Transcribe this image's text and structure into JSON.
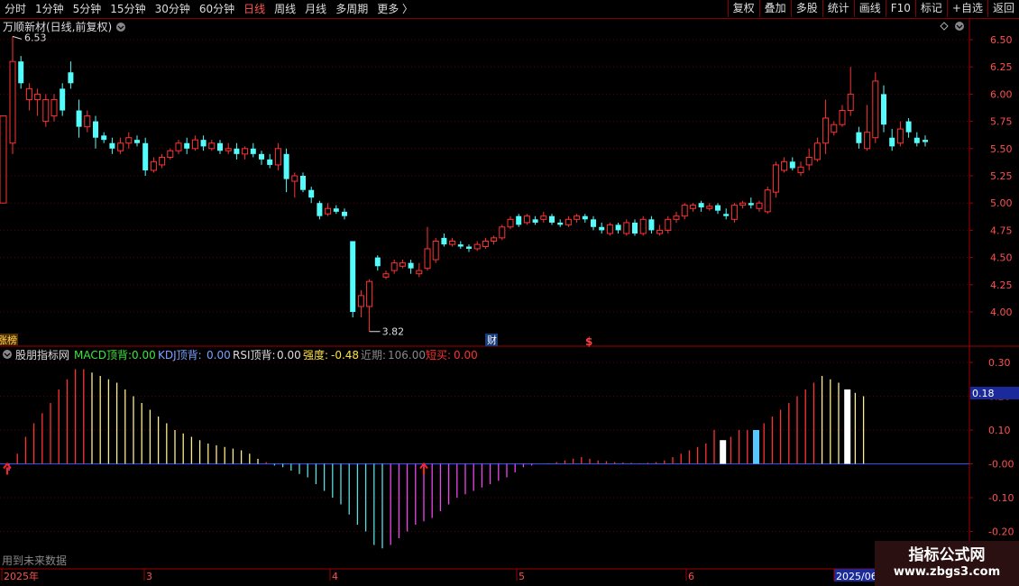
{
  "toolbar": {
    "items": [
      "分时",
      "1分钟",
      "5分钟",
      "15分钟",
      "30分钟",
      "60分钟",
      "日线",
      "周线",
      "月线",
      "多周期",
      "更多 〉"
    ],
    "active_index": 6,
    "right_buttons": [
      "复权",
      "叠加",
      "多股",
      "统计",
      "画线",
      "F10",
      "标记",
      "+自选",
      "返回"
    ]
  },
  "main_chart": {
    "title": "万顺新材(日线,前复权)",
    "high_label": "6.53",
    "low_label": "3.82",
    "price_ticks": [
      "6.50",
      "6.25",
      "6.00",
      "5.75",
      "5.50",
      "5.25",
      "5.00",
      "4.75",
      "4.50",
      "4.25",
      "4.00"
    ],
    "left_tag": "涨榜",
    "event_cai": "财",
    "event_dollar": "$",
    "colors": {
      "up": "#ff3232",
      "down": "#54fcfc",
      "grid": "#5a0000",
      "axis": "#a00000"
    }
  },
  "indicator": {
    "name": "股朋指标网",
    "macd_label": "MACD顶背:",
    "macd_value": "0.00",
    "kdj_label": "KDJ顶背:",
    "kdj_value": "0.00",
    "rsi_label": "RSI顶背:",
    "rsi_value": "0.00",
    "strength_label": "强度:",
    "strength_value": "-0.48",
    "recent_label": "近期:",
    "recent_value": "106.00",
    "buy_label": "短买:",
    "buy_value": "0.00",
    "ticks": [
      "0.30",
      "0.20",
      "0.10",
      "-0.00",
      "-0.10",
      "-0.20"
    ],
    "current_value": "0.18",
    "footnote": "用到未来数据"
  },
  "date_axis": {
    "labels": [
      "2025年",
      "3",
      "4",
      "5",
      "6",
      "2025/06"
    ]
  },
  "watermark": {
    "title": "指标公式网",
    "url": "www.zbgs3.com"
  },
  "chart_data": {
    "type": "candlestick",
    "price_range": [
      3.82,
      6.53
    ],
    "candles": [
      [
        5.55,
        6.3,
        6.53,
        5.45
      ],
      [
        6.3,
        6.1,
        6.35,
        6.05
      ],
      [
        5.95,
        6.05,
        6.1,
        5.85
      ],
      [
        5.95,
        6.0,
        6.05,
        5.8
      ],
      [
        5.75,
        5.95,
        6.0,
        5.7
      ],
      [
        5.8,
        5.95,
        6.0,
        5.75
      ],
      [
        6.05,
        5.85,
        6.1,
        5.8
      ],
      [
        6.2,
        6.1,
        6.3,
        6.05
      ],
      [
        5.85,
        5.7,
        5.95,
        5.6
      ],
      [
        5.7,
        5.8,
        5.85,
        5.65
      ],
      [
        5.75,
        5.6,
        5.8,
        5.5
      ],
      [
        5.62,
        5.58,
        5.65,
        5.55
      ],
      [
        5.55,
        5.5,
        5.6,
        5.45
      ],
      [
        5.48,
        5.55,
        5.6,
        5.45
      ],
      [
        5.55,
        5.6,
        5.65,
        5.5
      ],
      [
        5.58,
        5.55,
        5.62,
        5.52
      ],
      [
        5.55,
        5.3,
        5.6,
        5.25
      ],
      [
        5.3,
        5.38,
        5.42,
        5.28
      ],
      [
        5.35,
        5.42,
        5.45,
        5.32
      ],
      [
        5.42,
        5.48,
        5.5,
        5.4
      ],
      [
        5.48,
        5.55,
        5.58,
        5.45
      ],
      [
        5.55,
        5.5,
        5.6,
        5.45
      ],
      [
        5.5,
        5.58,
        5.62,
        5.48
      ],
      [
        5.58,
        5.52,
        5.62,
        5.48
      ],
      [
        5.5,
        5.55,
        5.58,
        5.48
      ],
      [
        5.55,
        5.48,
        5.58,
        5.45
      ],
      [
        5.48,
        5.5,
        5.55,
        5.45
      ],
      [
        5.5,
        5.45,
        5.55,
        5.4
      ],
      [
        5.45,
        5.5,
        5.52,
        5.4
      ],
      [
        5.5,
        5.45,
        5.55,
        5.42
      ],
      [
        5.45,
        5.4,
        5.48,
        5.35
      ],
      [
        5.4,
        5.35,
        5.45,
        5.32
      ],
      [
        5.35,
        5.5,
        5.55,
        5.3
      ],
      [
        5.45,
        5.22,
        5.5,
        5.1
      ],
      [
        5.2,
        5.25,
        5.28,
        5.05
      ],
      [
        5.25,
        5.12,
        5.28,
        5.1
      ],
      [
        5.12,
        5.05,
        5.15,
        5.0
      ],
      [
        5.0,
        4.88,
        5.02,
        4.85
      ],
      [
        4.9,
        4.95,
        5.0,
        4.88
      ],
      [
        4.95,
        4.92,
        4.98,
        4.9
      ],
      [
        4.92,
        4.88,
        4.95,
        4.85
      ],
      [
        4.65,
        4.0,
        4.65,
        3.95
      ],
      [
        4.05,
        4.15,
        4.2,
        3.95
      ],
      [
        4.05,
        4.28,
        4.3,
        3.82
      ],
      [
        4.5,
        4.42,
        4.52,
        4.38
      ],
      [
        4.32,
        4.35,
        4.38,
        4.3
      ],
      [
        4.38,
        4.45,
        4.48,
        4.35
      ],
      [
        4.42,
        4.45,
        4.48,
        4.4
      ],
      [
        4.45,
        4.4,
        4.48,
        4.35
      ],
      [
        4.35,
        4.38,
        4.45,
        4.32
      ],
      [
        4.4,
        4.58,
        4.78,
        4.38
      ],
      [
        4.48,
        4.65,
        4.68,
        4.45
      ],
      [
        4.68,
        4.62,
        4.72,
        4.6
      ],
      [
        4.62,
        4.65,
        4.68,
        4.6
      ],
      [
        4.62,
        4.6,
        4.65,
        4.58
      ],
      [
        4.6,
        4.58,
        4.62,
        4.55
      ],
      [
        4.58,
        4.62,
        4.65,
        4.56
      ],
      [
        4.6,
        4.65,
        4.68,
        4.58
      ],
      [
        4.65,
        4.68,
        4.7,
        4.62
      ],
      [
        4.68,
        4.78,
        4.8,
        4.66
      ],
      [
        4.78,
        4.85,
        4.88,
        4.76
      ],
      [
        4.88,
        4.8,
        4.9,
        4.78
      ],
      [
        4.82,
        4.88,
        4.9,
        4.8
      ],
      [
        4.85,
        4.82,
        4.88,
        4.8
      ],
      [
        4.85,
        4.88,
        4.92,
        4.82
      ],
      [
        4.88,
        4.82,
        4.9,
        4.8
      ],
      [
        4.82,
        4.8,
        4.85,
        4.78
      ],
      [
        4.8,
        4.85,
        4.88,
        4.78
      ],
      [
        4.85,
        4.88,
        4.9,
        4.82
      ],
      [
        4.88,
        4.85,
        4.9,
        4.82
      ],
      [
        4.85,
        4.78,
        4.88,
        4.75
      ],
      [
        4.78,
        4.75,
        4.82,
        4.72
      ],
      [
        4.72,
        4.8,
        4.82,
        4.7
      ],
      [
        4.8,
        4.75,
        4.82,
        4.72
      ],
      [
        4.72,
        4.82,
        4.85,
        4.7
      ],
      [
        4.82,
        4.72,
        4.85,
        4.7
      ],
      [
        4.72,
        4.85,
        4.88,
        4.7
      ],
      [
        4.85,
        4.75,
        4.88,
        4.72
      ],
      [
        4.72,
        4.75,
        4.8,
        4.7
      ],
      [
        4.75,
        4.85,
        4.88,
        4.72
      ],
      [
        4.85,
        4.88,
        4.92,
        4.82
      ],
      [
        4.88,
        4.98,
        5.0,
        4.85
      ],
      [
        4.95,
        4.98,
        5.0,
        4.92
      ],
      [
        5.0,
        4.96,
        5.02,
        4.92
      ],
      [
        4.95,
        4.97,
        5.0,
        4.93
      ],
      [
        4.98,
        4.93,
        5.0,
        4.9
      ],
      [
        4.9,
        4.88,
        4.95,
        4.85
      ],
      [
        4.85,
        4.98,
        5.0,
        4.82
      ],
      [
        4.98,
        5.0,
        5.02,
        4.95
      ],
      [
        5.0,
        4.98,
        5.05,
        4.95
      ],
      [
        4.95,
        5.0,
        5.02,
        4.92
      ],
      [
        4.92,
        5.12,
        5.15,
        4.9
      ],
      [
        5.1,
        5.35,
        5.38,
        5.05
      ],
      [
        5.3,
        5.38,
        5.42,
        5.28
      ],
      [
        5.38,
        5.32,
        5.42,
        5.3
      ],
      [
        5.28,
        5.33,
        5.38,
        5.25
      ],
      [
        5.35,
        5.42,
        5.5,
        5.3
      ],
      [
        5.4,
        5.55,
        5.6,
        5.38
      ],
      [
        5.55,
        5.78,
        5.95,
        5.45
      ],
      [
        5.65,
        5.72,
        5.75,
        5.62
      ],
      [
        5.72,
        5.85,
        5.9,
        5.7
      ],
      [
        5.85,
        6.0,
        6.25,
        5.8
      ],
      [
        5.65,
        5.55,
        5.7,
        5.5
      ],
      [
        5.5,
        5.65,
        5.9,
        5.48
      ],
      [
        5.6,
        6.12,
        6.2,
        5.55
      ],
      [
        6.0,
        5.72,
        6.08,
        5.65
      ],
      [
        5.6,
        5.52,
        5.68,
        5.48
      ],
      [
        5.55,
        5.68,
        5.75,
        5.52
      ],
      [
        5.75,
        5.65,
        5.78,
        5.6
      ],
      [
        5.6,
        5.55,
        5.65,
        5.52
      ],
      [
        5.58,
        5.56,
        5.62,
        5.52
      ]
    ],
    "indicator_bars": [
      -0.02,
      0.03,
      0.08,
      0.12,
      0.15,
      0.18,
      0.22,
      0.25,
      0.28,
      0.28,
      0.27,
      0.26,
      0.25,
      0.24,
      0.22,
      0.2,
      0.18,
      0.16,
      0.14,
      0.12,
      0.1,
      0.09,
      0.08,
      0.07,
      0.06,
      0.055,
      0.05,
      0.045,
      0.04,
      0.03,
      0.015,
      0.005,
      -0.005,
      -0.01,
      -0.02,
      -0.03,
      -0.04,
      -0.06,
      -0.08,
      -0.1,
      -0.12,
      -0.15,
      -0.18,
      -0.2,
      -0.24,
      -0.25,
      -0.24,
      -0.22,
      -0.2,
      -0.18,
      -0.17,
      -0.16,
      -0.14,
      -0.12,
      -0.1,
      -0.09,
      -0.08,
      -0.07,
      -0.06,
      -0.05,
      -0.04,
      -0.025,
      -0.01,
      -0.005,
      0.0,
      0.002,
      0.005,
      0.01,
      0.015,
      0.02,
      0.015,
      0.01,
      0.008,
      0.005,
      0.004,
      0.003,
      0.002,
      0.003,
      0.005,
      0.01,
      0.02,
      0.03,
      0.04,
      0.05,
      0.06,
      0.1,
      0.07,
      0.08,
      0.1,
      0.1,
      0.1,
      0.12,
      0.14,
      0.16,
      0.18,
      0.2,
      0.22,
      0.24,
      0.26,
      0.25,
      0.24,
      0.22,
      0.21,
      0.2
    ],
    "indicator_range": [
      -0.2,
      0.3
    ],
    "bar_color_sequence": [
      "red",
      "yellow",
      "cyan",
      "magenta"
    ],
    "signal_markers": [
      0,
      50
    ],
    "highlight_bars": [
      86,
      90,
      101
    ]
  }
}
